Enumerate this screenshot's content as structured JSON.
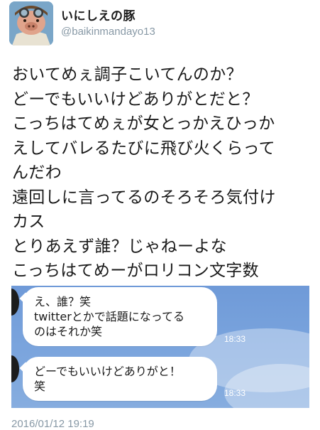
{
  "tweet": {
    "display_name": "いにしえの豚",
    "handle": "@baikinmandayo13",
    "avatar_icon": "pig-pilot-avatar-icon",
    "lines": [
      "おいてめぇ調子こいてんのか？",
      "どーでもいいけどありがとだと？",
      "こっちはてめぇが女とっかえひっか",
      "えしてバレるたびに飛び火くらって",
      "んだわ",
      "遠回しに言ってるのそろそろ気付け",
      "カス",
      "とりあえず誰？じゃねーよな",
      "こっちはてめーがロリコン文字数"
    ],
    "timestamp": "2016/01/12 19:19"
  },
  "chat": {
    "background_color": "#7aa4dd",
    "messages": [
      {
        "lines": [
          "え、誰？笑",
          "twitterとかで話題になってる",
          "のはそれか笑"
        ],
        "time": "18:33"
      },
      {
        "lines": [
          "どーでもいいけどありがと！",
          "笑"
        ],
        "time": "18:33"
      }
    ]
  }
}
